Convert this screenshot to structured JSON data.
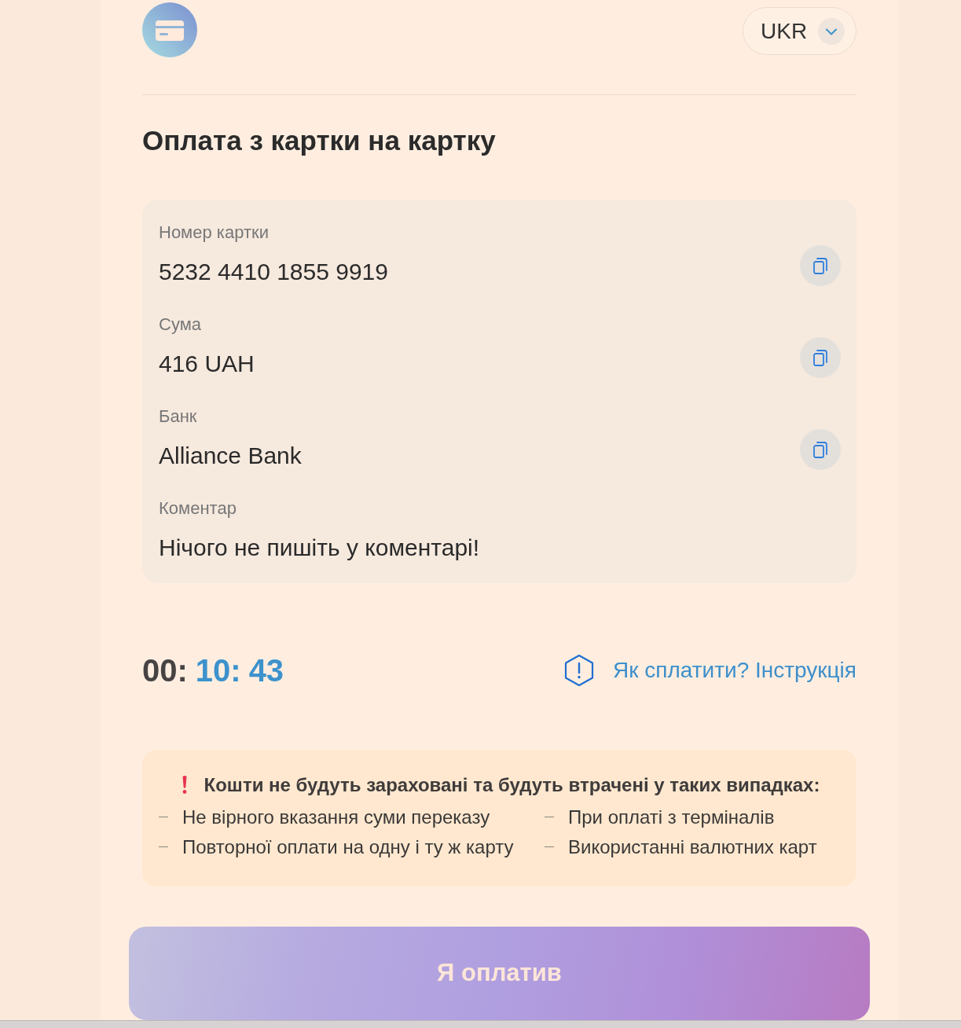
{
  "header": {
    "language": {
      "label": "UKR"
    }
  },
  "title": "Оплата з картки на картку",
  "details": [
    {
      "label": "Номер картки",
      "value": "5232 4410 1855 9919",
      "copyable": true
    },
    {
      "label": "Сума",
      "value": "416 UAH",
      "copyable": true
    },
    {
      "label": "Банк",
      "value": "Alliance Bank",
      "copyable": true
    },
    {
      "label": "Коментар",
      "value": "Нічого не пишіть у коментарі!",
      "copyable": false
    }
  ],
  "timer": [
    {
      "text": "00:",
      "highlighted": false
    },
    {
      "text": "10:",
      "highlighted": true
    },
    {
      "text": "43",
      "highlighted": true
    }
  ],
  "instruction_link": "Як сплатити? Інструкція",
  "warning": {
    "heading": "Кошти не будуть зараховані та будуть втрачені у таких випадках:",
    "items": [
      "Не вірного вказання суми переказу",
      "При оплаті з терміналів",
      "Повторної оплати на одну і ту ж карту",
      "Використанні валютних карт"
    ]
  },
  "confirm_button": "Я оплатив"
}
